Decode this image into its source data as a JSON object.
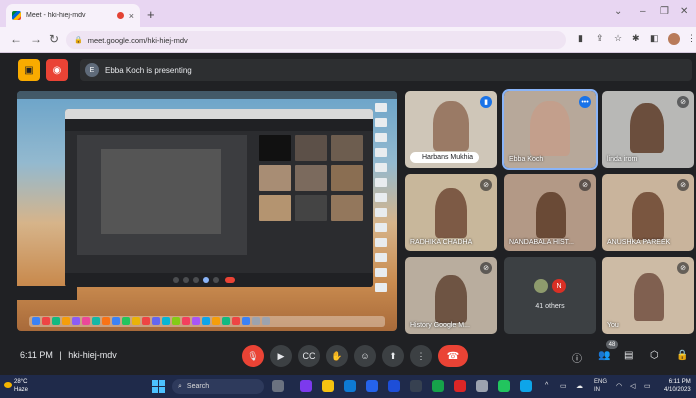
{
  "browser": {
    "tab_title": "Meet - hki-hiej-mdv",
    "tab_close": "×",
    "new_tab": "+",
    "url": "meet.google.com/hki-hiej-mdv",
    "nav": {
      "back": "←",
      "forward": "→",
      "reload": "↻"
    }
  },
  "meet": {
    "presenting_avatar": "E",
    "presenting_text": "Ebba Koch is presenting",
    "meeting_time": "6:11 PM",
    "meeting_separator": "|",
    "meeting_code": "hki-hiej-mdv",
    "people_count": "48"
  },
  "participants": [
    {
      "name": "Harbans Mukhia"
    },
    {
      "name": "Ebba Koch"
    },
    {
      "name": "linda irom"
    },
    {
      "name": "RADHIKA CHADHA"
    },
    {
      "name": "NANDABALA HIST..."
    },
    {
      "name": "ANUSHKA PAREEK"
    },
    {
      "name": "History Google M..."
    },
    {
      "name": "You"
    }
  ],
  "others": {
    "label": "41 others",
    "avatar_letter": "N"
  },
  "taskbar": {
    "temp": "28°C",
    "weather": "Haze",
    "search": "Search",
    "lang": "ENG",
    "lang2": "IN",
    "time": "6:11 PM",
    "date": "4/10/2023"
  },
  "colors": {
    "accent_blue": "#8ab4f8",
    "end_call_red": "#ea4335",
    "meet_bg": "#202124",
    "tab_bg": "#e8d6f2"
  }
}
